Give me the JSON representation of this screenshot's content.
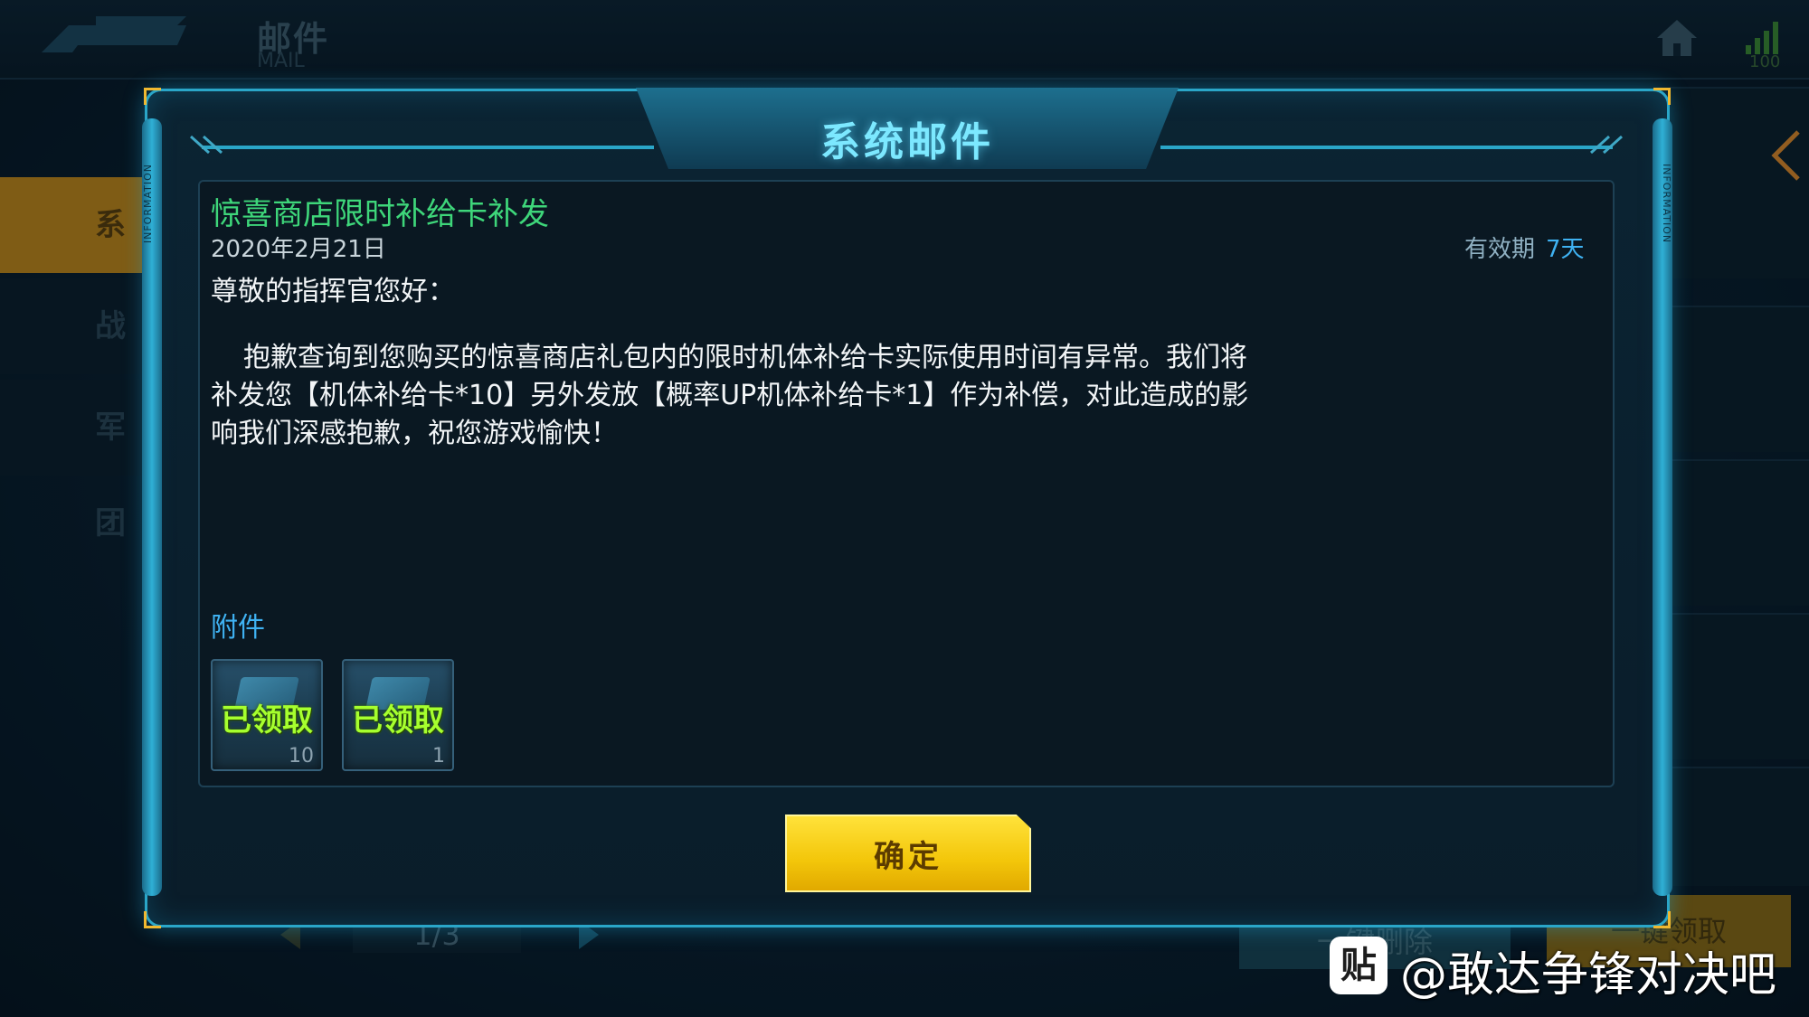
{
  "screen": {
    "title": "邮件",
    "subtitle": "MAIL",
    "signal": "100",
    "nav": [
      {
        "label": "系统"
      },
      {
        "label": "战报"
      },
      {
        "label": "军团"
      }
    ],
    "pager": "1/3",
    "delete_all_label": "一键删除",
    "claim_all_label": "一键领取"
  },
  "dialog": {
    "title": "系统邮件",
    "rail_text": "INFORMATION",
    "subject": "惊喜商店限时补给卡补发",
    "date": "2020年2月21日",
    "validity_label": "有效期",
    "validity_value": "7天",
    "greeting": "尊敬的指挥官您好：",
    "body": "抱歉查询到您购买的惊喜商店礼包内的限时机体补给卡实际使用时间有异常。我们将补发您【机体补给卡*10】另外发放【概率UP机体补给卡*1】作为补偿，对此造成的影响我们深感抱歉，祝您游戏愉快！",
    "attachments_label": "附件",
    "attachments": [
      {
        "status": "已领取",
        "count": "10"
      },
      {
        "status": "已领取",
        "count": "1"
      }
    ],
    "confirm_label": "确定"
  },
  "watermark": {
    "icon": "贴",
    "text": "@敢达争锋对决吧"
  },
  "colors": {
    "accent_cyan": "#2aa6c8",
    "title_cyan": "#7ce8ff",
    "subject_green": "#3ed67a",
    "claimed_green": "#a6ff2e",
    "link_blue": "#3fb2f2",
    "confirm_yellow": "#f3c60a",
    "nav_active": "#c4891a"
  }
}
